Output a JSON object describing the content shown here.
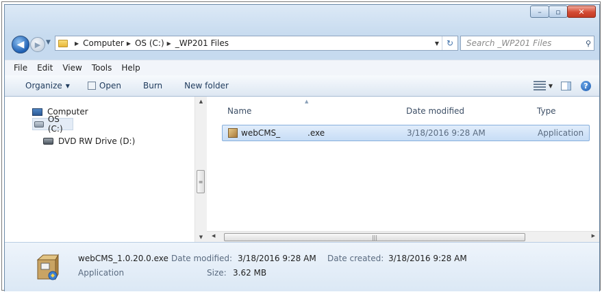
{
  "window": {
    "controls": {
      "minimize": "–",
      "maximize": "▫",
      "close": "✕"
    }
  },
  "address_bar": {
    "breadcrumbs": [
      "Computer",
      "OS (C:)",
      "_WP201 Files"
    ]
  },
  "search": {
    "placeholder": "Search _WP201 Files"
  },
  "menubar": {
    "items": [
      "File",
      "Edit",
      "View",
      "Tools",
      "Help"
    ]
  },
  "toolbar": {
    "organize": "Organize",
    "open": "Open",
    "burn": "Burn",
    "new_folder": "New folder"
  },
  "nav_pane": {
    "items": [
      {
        "label": "Computer",
        "icon": "computer-icon"
      },
      {
        "label": "OS (C:)",
        "icon": "drive-icon",
        "selected": true
      },
      {
        "label": "DVD RW Drive (D:)",
        "icon": "dvd-drive-icon"
      }
    ]
  },
  "file_list": {
    "columns": [
      "Name",
      "Date modified",
      "Type"
    ],
    "rows": [
      {
        "name_prefix": "webCMS_",
        "name_suffix": ".exe",
        "date_modified": "3/18/2016 9:28 AM",
        "type": "Application"
      }
    ]
  },
  "details_pane": {
    "filename": "webCMS_1.0.20.0.exe",
    "type": "Application",
    "date_modified_label": "Date modified:",
    "date_modified": "3/18/2016 9:28 AM",
    "date_created_label": "Date created:",
    "date_created": "3/18/2016 9:28 AM",
    "size_label": "Size:",
    "size": "3.62 MB"
  },
  "colors": {
    "accent": "#1d5fb3",
    "selection": "#c7ddf6",
    "close_button": "#d34a33"
  }
}
